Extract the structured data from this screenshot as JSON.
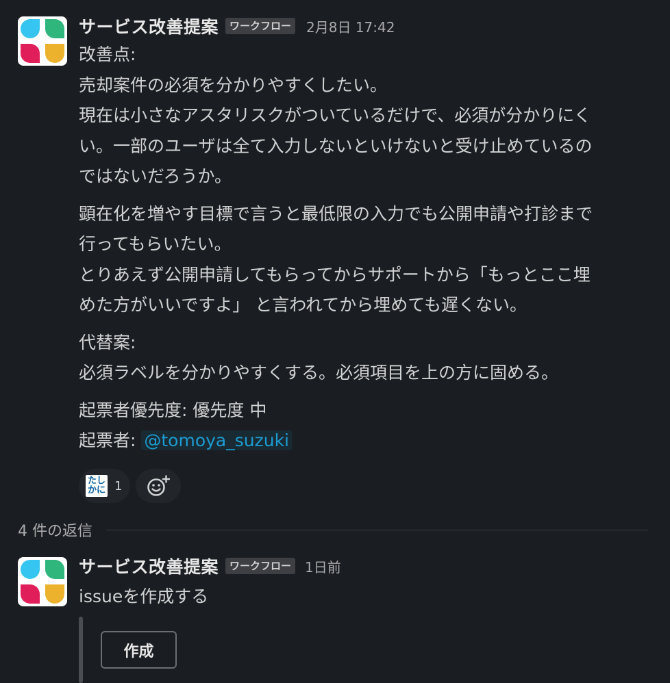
{
  "message": {
    "sender": "サービス改善提案",
    "badge": "ワークフロー",
    "timestamp": "2月8日 17:42",
    "paragraphs": [
      [
        "改善点:",
        "売却案件の必須を分かりやすくしたい。",
        "現在は小さなアスタリスクがついているだけで、必須が分かりにく",
        "い。一部のユーザは全て入力しないといけないと受け止めているの",
        "ではないだろうか。"
      ],
      [
        "顕在化を増やす目標で言うと最低限の入力でも公開申請や打診まで",
        "行ってもらいたい。",
        "とりあえず公開申請してもらってからサポートから「もっとここ埋",
        "めた方がいいですよ」 と言われてから埋めても遅くない。"
      ],
      [
        "代替案:",
        "必須ラベルを分かりやすくする。必須項目を上の方に固める。"
      ],
      [
        "起票者優先度: 優先度 中"
      ]
    ],
    "reporter_label": "起票者: ",
    "reporter_mention": "@tomoya_suzuki",
    "reaction": {
      "emoji_line1": "たし",
      "emoji_line2": "かに",
      "count": "1"
    }
  },
  "thread": {
    "replies_label": "4 件の返信"
  },
  "reply": {
    "sender": "サービス改善提案",
    "badge": "ワークフロー",
    "timestamp": "1日前",
    "text": "issueを作成する",
    "button_label": "作成"
  },
  "colors": {
    "background": "#1a1d21",
    "text": "#d1d2d3",
    "mention": "#1d9bd1",
    "logo_blue": "#36c5f0",
    "logo_green": "#2eb67d",
    "logo_red": "#e01e5a",
    "logo_yellow": "#ecb22e"
  }
}
